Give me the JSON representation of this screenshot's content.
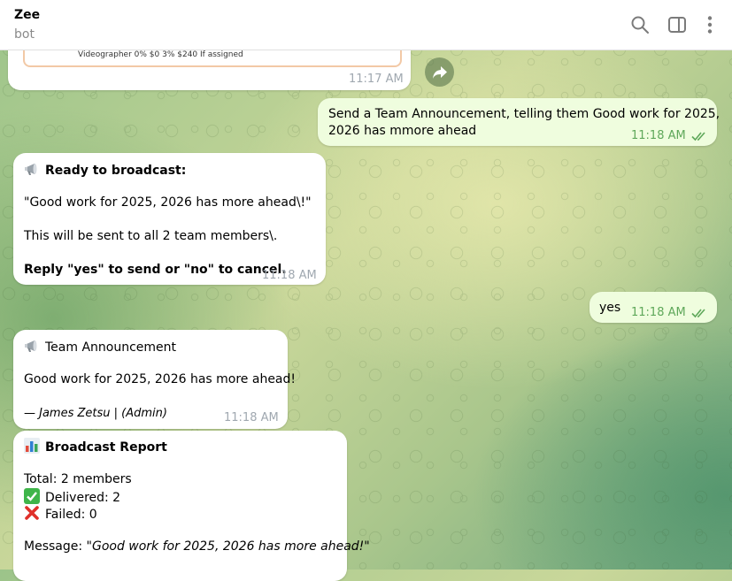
{
  "header": {
    "title": "Zee",
    "subtitle": "bot",
    "icons": [
      "search-icon",
      "sidebar-toggle-icon",
      "more-vertical-icon"
    ]
  },
  "messages": [
    {
      "id": "m1",
      "direction": "in",
      "embed_text": "Videographer 0% $0 3% $240 If assigned",
      "time": "11:17 AM"
    },
    {
      "id": "m2",
      "direction": "out",
      "text_line1": "Send a Team Announcement, telling them Good work for 2025,",
      "text_line2": "2026 has mmore ahead",
      "time": "11:18 AM",
      "read": true
    },
    {
      "id": "m3",
      "direction": "in",
      "heading": "Ready to broadcast:",
      "quote": "\"Good work for 2025, 2026 has more ahead\\!\"",
      "body": "This will be sent to all 2 team members\\.",
      "instruction": "Reply \"yes\" to send or \"no\" to cancel.",
      "time": "11:18 AM"
    },
    {
      "id": "m4",
      "direction": "out",
      "text": "yes",
      "time": "11:18 AM",
      "read": true
    },
    {
      "id": "m5",
      "direction": "in",
      "heading": "Team Announcement",
      "body": "Good work for 2025, 2026 has more ahead!",
      "signature": "— James Zetsu | (Admin)",
      "time": "11:18 AM"
    },
    {
      "id": "m6",
      "direction": "in",
      "heading": "Broadcast Report",
      "total": "Total: 2 members",
      "delivered": "Delivered: 2",
      "failed": "Failed: 0",
      "message_label": "Message: ",
      "message_value": "\"Good work for 2025, 2026 has more ahead!\""
    }
  ],
  "colors": {
    "incoming_bubble": "#ffffff",
    "outgoing_bubble": "#effdde",
    "outgoing_time": "#5fa85a",
    "incoming_time": "#a0a8b0"
  }
}
